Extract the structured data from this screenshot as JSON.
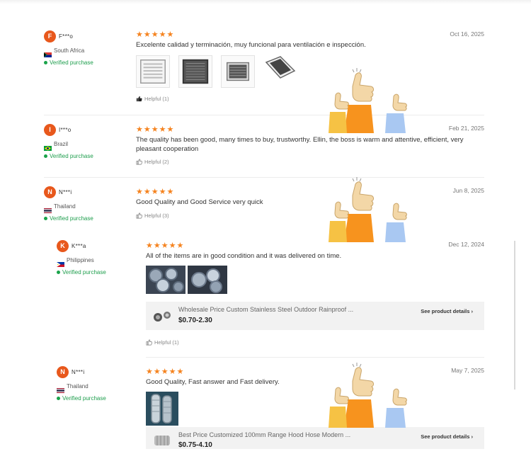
{
  "reviews": [
    {
      "avatar_letter": "F",
      "name": "F***o",
      "country": "South Africa",
      "verified": "Verified purchase",
      "stars": "★★★★★",
      "date": "Oct 16, 2025",
      "text": "Excelente calidad y terminación, muy funcional para ventilación e inspección.",
      "helpful": "Helpful (1)"
    },
    {
      "avatar_letter": "I",
      "name": "I***o",
      "country": "Brazil",
      "verified": "Verified purchase",
      "stars": "★★★★★",
      "date": "Feb 21, 2025",
      "text": "The quality has been good, many times to buy, trustworthy. Ellin, the boss is warm and attentive, efficient, very pleasant cooperation",
      "helpful": "Helpful (2)"
    },
    {
      "avatar_letter": "N",
      "name": "N***i",
      "country": "Thailand",
      "verified": "Verified purchase",
      "stars": "★★★★★",
      "date": "Jun 8, 2025",
      "text": "Good Quality and Good Service very quick",
      "helpful": "Helpful (3)"
    },
    {
      "avatar_letter": "K",
      "name": "K***a",
      "country": "Philippines",
      "verified": "Verified purchase",
      "stars": "★★★★★",
      "date": "Dec 12, 2024",
      "text": "All of the items are in good condition and it was delivered on time.",
      "product_title": "Wholesale Price Custom Stainless Steel Outdoor Rainproof ...",
      "product_price": "$0.70-2.30",
      "see_details": "See product details",
      "helpful": "Helpful (1)"
    },
    {
      "avatar_letter": "N",
      "name": "N***i",
      "country": "Thailand",
      "verified": "Verified purchase",
      "stars": "★★★★★",
      "date": "May 7, 2025",
      "text": "Good Quality, Fast answer and Fast delivery.",
      "product_title": "Best Price Customized 100mm Range Hood Hose Modern ...",
      "product_price": "$0.75-4.10",
      "see_details": "See product details"
    }
  ],
  "colors": {
    "star": "#f5831f",
    "avatar": "#e8581c",
    "verified": "#1e9e4d",
    "sticker_orange": "#f7931e",
    "sticker_skin": "#f3d7a7"
  },
  "icons": {
    "helpful": "thumbs-up-icon",
    "verified": "check-dot-icon",
    "see_details": "chevron-right-icon",
    "sticker": "thumbs-up-hands-icon"
  }
}
